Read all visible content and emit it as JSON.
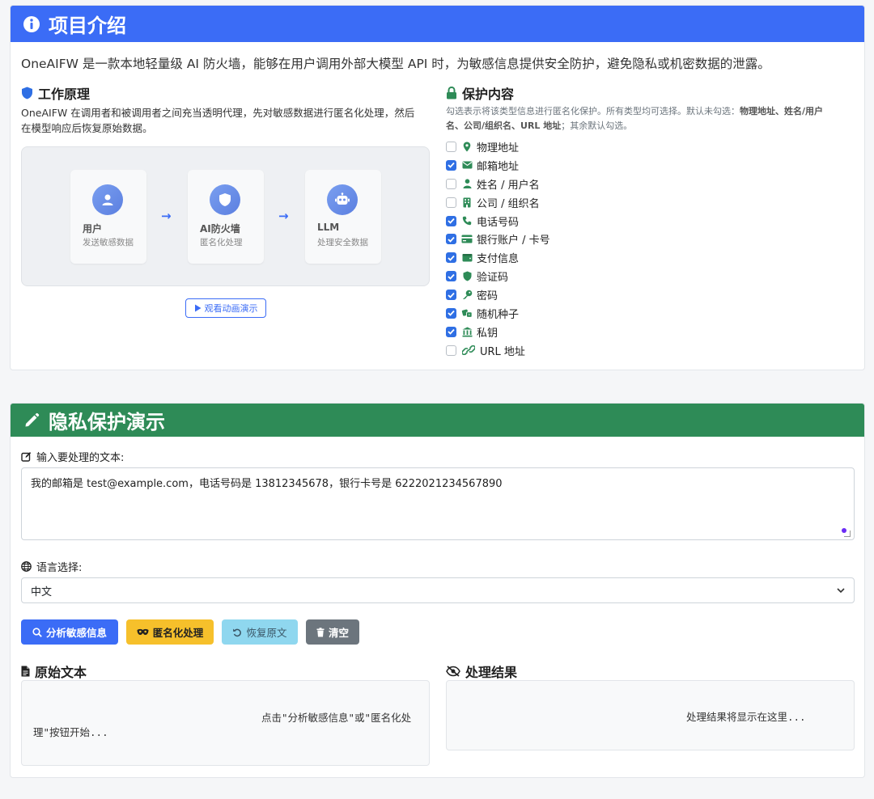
{
  "intro_card": {
    "title": "项目介绍",
    "intro": "OneAIFW 是一款本地轻量级 AI 防火墙，能够在用户调用外部大模型 API 时，为敏感信息提供安全防护，避免隐私或机密数据的泄露。",
    "principle": {
      "title": "工作原理",
      "desc_line1": "OneAIFW 在调用者和被调用者之间充当透明代理，先对敏感数据进行匿名化处理，然后",
      "desc_line2": "在模型响应后恢复原始数据。",
      "nodes": [
        {
          "title": "用户",
          "sub": "发送敏感数据",
          "icon": "user-icon"
        },
        {
          "title": "AI防火墙",
          "sub": "匿名化处理",
          "icon": "shield-icon"
        },
        {
          "title": "LLM",
          "sub": "处理安全数据",
          "icon": "robot-icon"
        }
      ],
      "arrow": "→",
      "demo_button": "观看动画演示"
    },
    "protect": {
      "title": "保护内容",
      "hint_line1_a": "勾选表示将该类型信息进行匿名化保护。所有类型均可选择。默认未勾选：",
      "hint_line1_b": "物理地址、姓名/用户",
      "hint_line2_a": "名、公司/组织名、URL 地址",
      "hint_line2_b": "；其余默认勾选。",
      "items": [
        {
          "label": "物理地址",
          "checked": false,
          "icon": "map-pin-icon"
        },
        {
          "label": "邮箱地址",
          "checked": true,
          "icon": "envelope-icon"
        },
        {
          "label": "姓名 / 用户名",
          "checked": false,
          "icon": "person-icon"
        },
        {
          "label": "公司 / 组织名",
          "checked": false,
          "icon": "building-icon"
        },
        {
          "label": "电话号码",
          "checked": true,
          "icon": "phone-icon"
        },
        {
          "label": "银行账户 / 卡号",
          "checked": true,
          "icon": "credit-card-icon"
        },
        {
          "label": "支付信息",
          "checked": true,
          "icon": "wallet-icon"
        },
        {
          "label": "验证码",
          "checked": true,
          "icon": "shield-icon"
        },
        {
          "label": "密码",
          "checked": true,
          "icon": "key-icon"
        },
        {
          "label": "随机种子",
          "checked": true,
          "icon": "dice-icon"
        },
        {
          "label": "私钥",
          "checked": true,
          "icon": "vault-icon"
        },
        {
          "label": "URL 地址",
          "checked": false,
          "icon": "link-icon"
        }
      ]
    }
  },
  "demo_card": {
    "title": "隐私保护演示",
    "input_label": "输入要处理的文本:",
    "input_value": "我的邮箱是 test@example.com，电话号码是 13812345678，银行卡号是 6222021234567890",
    "lang_label": "语言选择:",
    "lang_value": "中文",
    "buttons": {
      "analyze": "分析敏感信息",
      "anonymize": "匿名化处理",
      "restore": "恢复原文",
      "clear": "清空"
    },
    "original_title": "原始文本",
    "original_placeholder_1": "点击\"分析敏感信息\"或\"匿名化处",
    "original_placeholder_2": "理\"按钮开始...",
    "result_title": "处理结果",
    "result_placeholder": "处理结果将显示在这里..."
  },
  "colors": {
    "primary": "#3b6cf6",
    "success": "#2e8b57",
    "warning": "#f6c02b",
    "info": "#8fd7ef",
    "secondary": "#6c757d"
  }
}
